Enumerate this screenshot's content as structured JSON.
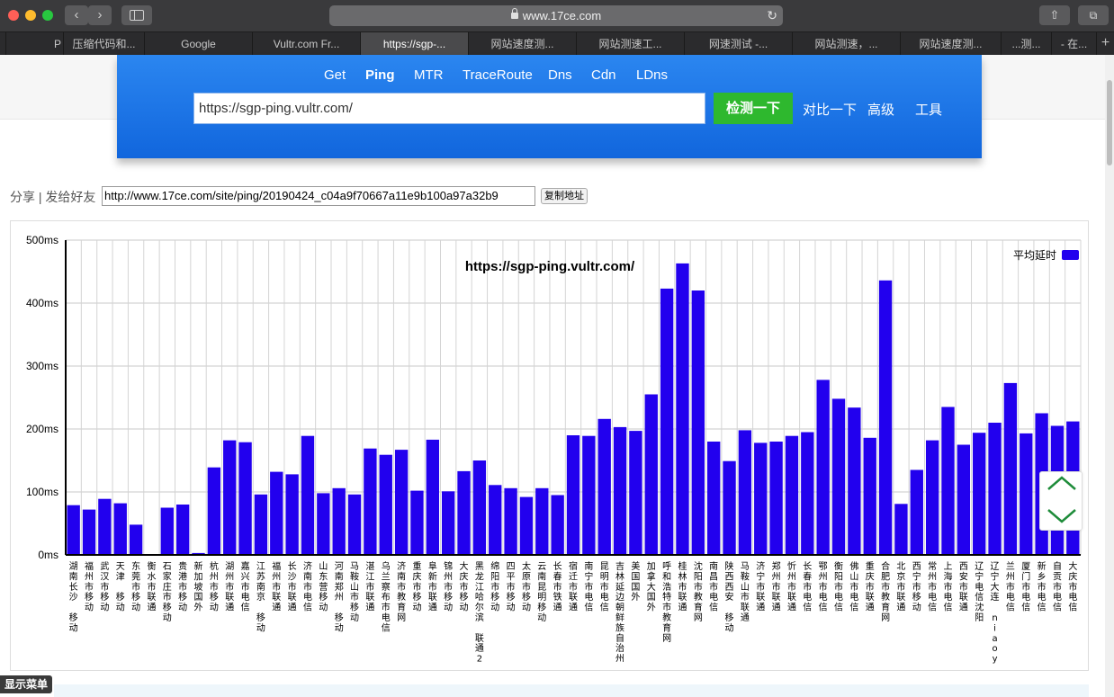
{
  "browser": {
    "url": "www.17ce.com",
    "tabs": [
      {
        "label": "P",
        "active": false
      },
      {
        "label": "压缩代码和...",
        "active": false
      },
      {
        "label": "Google",
        "active": false
      },
      {
        "label": "Vultr.com Fr...",
        "active": false
      },
      {
        "label": "https://sgp-...",
        "active": true
      },
      {
        "label": "网站速度测...",
        "active": false
      },
      {
        "label": "网站测速工...",
        "active": false
      },
      {
        "label": "网速测试 -...",
        "active": false
      },
      {
        "label": "网站测速，...",
        "active": false
      },
      {
        "label": "网站速度测...",
        "active": false
      },
      {
        "label": "...测...",
        "active": false
      },
      {
        "label": "- 在...",
        "active": false
      }
    ],
    "new_tab": "+"
  },
  "nav": {
    "items": [
      "Get",
      "Ping",
      "MTR",
      "TraceRoute",
      "Dns",
      "Cdn",
      "LDns"
    ],
    "active": "Ping"
  },
  "search": {
    "value": "https://sgp-ping.vultr.com/",
    "button": "检测一下",
    "links": [
      "对比一下",
      "高级",
      "工具"
    ]
  },
  "share": {
    "label": "分享 | 发给好友",
    "url": "http://www.17ce.com/site/ping/20190424_c04a9f70667a11e9b100a97a32b9",
    "copy_button": "复制地址"
  },
  "chart_data": {
    "type": "bar",
    "title": "https://sgp-ping.vultr.com/",
    "legend": {
      "label": "平均延时",
      "color": "#2200ee",
      "placement": "top-right"
    },
    "ylim": [
      0,
      500
    ],
    "yticks": [
      "0ms",
      "100ms",
      "200ms",
      "300ms",
      "400ms",
      "500ms"
    ],
    "grid": true,
    "bar_color": "#2200ee",
    "categories": [
      "湖南长沙 移动",
      "福州市移动",
      "武汉市移动",
      "天津 移动",
      "东莞市移动",
      "衡水市联通",
      "石家庄市移动",
      "贵港市移动",
      "新加坡国外",
      "杭州市移动",
      "湖州市联通",
      "嘉兴市电信",
      "江苏南京 移动",
      "福州市联通",
      "长沙市联通",
      "济南市电信",
      "山东营移动",
      "河南郑州 移动",
      "马鞍山市移动",
      "湛江市联通",
      "乌兰察布市电信",
      "济南市教育网",
      "重庆市移动",
      "阜新市联通",
      "锦州市移动",
      "大庆市移动",
      "黑龙江哈尔滨 联通2",
      "绵阳市移动",
      "四平市移动",
      "太原市移动",
      "云南昆明移动",
      "长春市铁通",
      "宿迁市联通",
      "南宁市电信",
      "昆明市电信",
      "吉林延边朝鲜族自治州",
      "美国国外",
      "加拿大国外",
      "呼和浩特市教育网",
      "桂林市联通",
      "沈阳市教育网",
      "南昌市电信",
      "陕西西安 移动",
      "马鞍山市联通",
      "济宁市联通",
      "郑州市联通",
      "忻州市联通",
      "长春市电信",
      "鄂州市电信",
      "衡阳市电信",
      "佛山市电信",
      "重庆市联通",
      "合肥市教育网",
      "北京市联通",
      "西宁市移动",
      "常州市电信",
      "上海市电信",
      "西安市联通",
      "辽宁电信沈阳",
      "辽宁大连 niaoy",
      "兰州市电信",
      "厦门市电信",
      "新乡市电信",
      "自贡市电信",
      "大庆市电信"
    ],
    "values": [
      79,
      72,
      89,
      82,
      48,
      0,
      75,
      80,
      3,
      139,
      182,
      179,
      96,
      132,
      128,
      189,
      98,
      106,
      96,
      169,
      159,
      167,
      102,
      183,
      101,
      133,
      150,
      111,
      106,
      92,
      106,
      95,
      190,
      189,
      216,
      203,
      197,
      255,
      423,
      463,
      420,
      180,
      149,
      198,
      178,
      180,
      189,
      195,
      278,
      248,
      234,
      186,
      436,
      81,
      135,
      182,
      235,
      175,
      194,
      210,
      273,
      193,
      225,
      205,
      212
    ]
  },
  "ui": {
    "show_menu": "显示菜单"
  }
}
